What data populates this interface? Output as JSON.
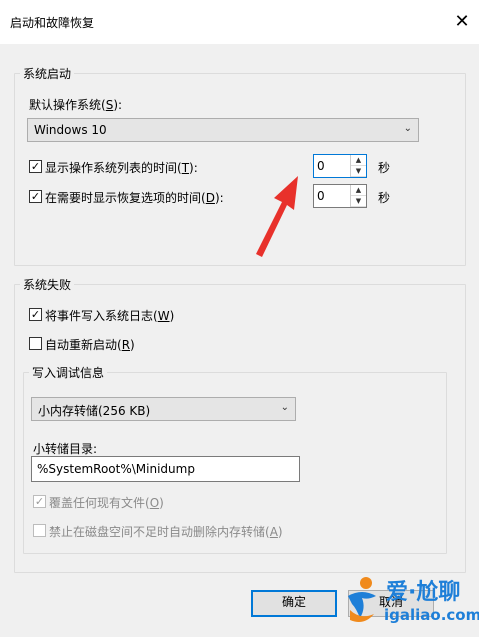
{
  "window": {
    "title": "启动和故障恢复",
    "close_glyph": "✕"
  },
  "system_startup": {
    "legend": "系统启动",
    "default_os_label": "默认操作系统(",
    "default_os_key": "S",
    "default_os_suffix": "):",
    "default_os_value": "Windows 10",
    "show_list_label": "显示操作系统列表的时间(",
    "show_list_key": "T",
    "show_list_suffix": "):",
    "show_list_checked": true,
    "show_list_value": "0",
    "show_recovery_label": "在需要时显示恢复选项的时间(",
    "show_recovery_key": "D",
    "show_recovery_suffix": "):",
    "show_recovery_checked": true,
    "show_recovery_value": "0",
    "seconds_unit": "秒"
  },
  "system_failure": {
    "legend": "系统失败",
    "write_event_label": "将事件写入系统日志(",
    "write_event_key": "W",
    "write_event_suffix": ")",
    "write_event_checked": true,
    "auto_restart_label": "自动重新启动(",
    "auto_restart_key": "R",
    "auto_restart_suffix": ")",
    "auto_restart_checked": false
  },
  "debug_info": {
    "legend": "写入调试信息",
    "dump_type_value": "小内存转储(256 KB)",
    "dump_dir_label": "小转储目录:",
    "dump_dir_value": "%SystemRoot%\\Minidump",
    "overwrite_label": "覆盖任何现有文件(",
    "overwrite_key": "O",
    "overwrite_suffix": ")",
    "overwrite_checked": true,
    "disable_auto_delete_label": "禁止在磁盘空间不足时自动删除内存转储(",
    "disable_auto_delete_key": "A",
    "disable_auto_delete_suffix": ")",
    "disable_auto_delete_checked": false
  },
  "buttons": {
    "ok": "确定",
    "cancel": "取消"
  },
  "watermark": {
    "brand": "爱·尬聊",
    "url": "igaliao.com"
  },
  "colors": {
    "accent": "#0078d7",
    "annotation_arrow": "#e8312b"
  }
}
